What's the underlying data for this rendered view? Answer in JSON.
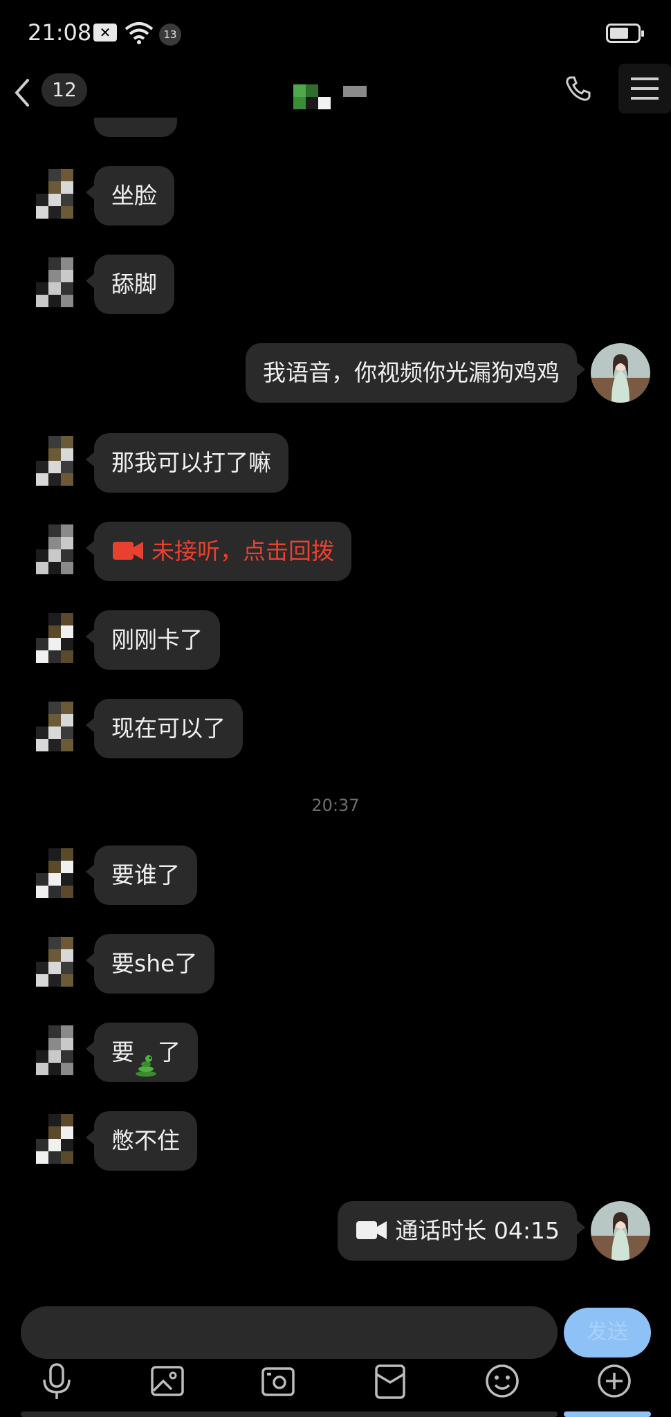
{
  "status_bar": {
    "time": "21:08",
    "notification_count": "13"
  },
  "nav": {
    "unread_count": "12"
  },
  "messages": [
    {
      "side": "left",
      "text": "坐脸"
    },
    {
      "side": "left",
      "text": "舔脚"
    },
    {
      "side": "right",
      "text": "我语音，你视频你光漏狗鸡鸡"
    },
    {
      "side": "left",
      "text": "那我可以打了嘛"
    },
    {
      "side": "left",
      "text": "未接听，点击回拨",
      "type": "missed-video-call"
    },
    {
      "side": "left",
      "text": "刚刚卡了"
    },
    {
      "side": "left",
      "text": "现在可以了"
    },
    {
      "type": "time",
      "text": "20:37"
    },
    {
      "side": "left",
      "text": "要谁了"
    },
    {
      "side": "left",
      "text": "要she了"
    },
    {
      "side": "left",
      "text_before": "要",
      "emoji": "snake-emoji",
      "text_after": "了"
    },
    {
      "side": "left",
      "text": "憋不住"
    },
    {
      "side": "right",
      "text": "通话时长 04:15",
      "type": "video-call-duration"
    }
  ],
  "input": {
    "send_label": "发送"
  },
  "toolbar": {
    "icons": [
      "microphone-icon",
      "image-icon",
      "camera-icon",
      "red-packet-icon",
      "emoji-icon",
      "plus-icon"
    ]
  },
  "colors": {
    "background": "#000000",
    "bubble": "#2a2a2a",
    "missed_call": "#e8412f",
    "send_button": "#8ec1f5"
  }
}
